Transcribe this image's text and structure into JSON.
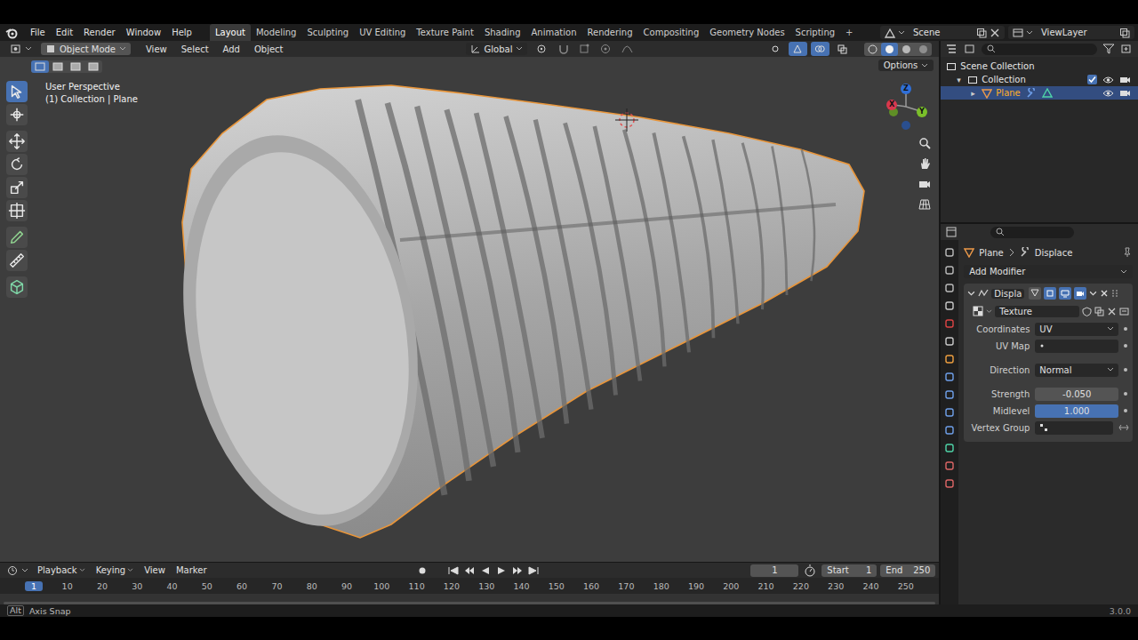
{
  "menus": [
    "File",
    "Edit",
    "Render",
    "Window",
    "Help"
  ],
  "workspaces": [
    {
      "label": "Layout",
      "selected": true
    },
    {
      "label": "Modeling",
      "selected": false
    },
    {
      "label": "Sculpting",
      "selected": false
    },
    {
      "label": "UV Editing",
      "selected": false
    },
    {
      "label": "Texture Paint",
      "selected": false
    },
    {
      "label": "Shading",
      "selected": false
    },
    {
      "label": "Animation",
      "selected": false
    },
    {
      "label": "Rendering",
      "selected": false
    },
    {
      "label": "Compositing",
      "selected": false
    },
    {
      "label": "Geometry Nodes",
      "selected": false
    },
    {
      "label": "Scripting",
      "selected": false
    }
  ],
  "add_workspace": "+",
  "scene": "Scene",
  "view_layer": "ViewLayer",
  "viewport_header": {
    "mode": "Object Mode",
    "menus": [
      "View",
      "Select",
      "Add",
      "Object"
    ],
    "orientation": "Global",
    "toggles": [
      {
        "on": false
      },
      {
        "on": true
      },
      {
        "on": true
      },
      {
        "on": false
      }
    ],
    "shading": [
      {
        "selected": false
      },
      {
        "selected": true
      },
      {
        "selected": false
      },
      {
        "selected": false
      }
    ],
    "select_modes": [
      {
        "selected": true
      },
      {
        "selected": false
      },
      {
        "selected": false
      },
      {
        "selected": false
      }
    ]
  },
  "viewport": {
    "perspective": "User Perspective",
    "context": "(1) Collection | Plane",
    "options": "Options",
    "toolbar": [
      {
        "selected": true
      },
      {
        "selected": false
      },
      {
        "selected": false
      },
      {
        "selected": false
      },
      {
        "selected": false
      },
      {
        "selected": false
      },
      {
        "selected": false
      },
      {
        "selected": false
      },
      {
        "selected": false
      }
    ],
    "gizmo_axes": [
      {
        "label": "Z",
        "color": "#2f6fd8"
      },
      {
        "label": "Y",
        "color": "#7bbf2a"
      },
      {
        "label": "X",
        "color": "#d8384e"
      }
    ]
  },
  "outliner": {
    "items": [
      {
        "label": "Scene Collection",
        "kind": "scene",
        "arrow": "",
        "selected": false
      },
      {
        "label": "Collection",
        "kind": "collection",
        "arrow": "▾",
        "checked": true,
        "selected": false
      },
      {
        "label": "Plane",
        "kind": "object",
        "arrow": "▸",
        "selected": true
      }
    ]
  },
  "properties": {
    "breadcrumb": [
      "Plane",
      "Displace"
    ],
    "add_modifier": "Add Modifier",
    "modifier": {
      "name": "Displa",
      "toggles": [
        {
          "on": false
        },
        {
          "on": true
        },
        {
          "on": true
        },
        {
          "on": true
        }
      ],
      "texture": "Texture",
      "fields": [
        {
          "label": "Coordinates",
          "value": "UV",
          "kind": "dropdown"
        },
        {
          "label": "UV Map",
          "value": "",
          "kind": "search"
        },
        {
          "label": "Direction",
          "value": "Normal",
          "kind": "dropdown"
        },
        {
          "label": "Strength",
          "value": "-0.050",
          "kind": "number"
        },
        {
          "label": "Midlevel",
          "value": "1.000",
          "kind": "slider",
          "level": 1
        },
        {
          "label": "Vertex Group",
          "value": "",
          "kind": "group"
        }
      ]
    }
  },
  "timeline": {
    "menus": [
      "Playback",
      "Keying",
      "View",
      "Marker"
    ],
    "current_frame": "1",
    "start_label": "Start",
    "start": "1",
    "end_label": "End",
    "end": "250",
    "ruler": [
      {
        "label": "1",
        "selected": true
      },
      {
        "label": "10",
        "selected": false
      },
      {
        "label": "20",
        "selected": false
      },
      {
        "label": "30",
        "selected": false
      },
      {
        "label": "40",
        "selected": false
      },
      {
        "label": "50",
        "selected": false
      },
      {
        "label": "60",
        "selected": false
      },
      {
        "label": "70",
        "selected": false
      },
      {
        "label": "80",
        "selected": false
      },
      {
        "label": "90",
        "selected": false
      },
      {
        "label": "100",
        "selected": false
      },
      {
        "label": "110",
        "selected": false
      },
      {
        "label": "120",
        "selected": false
      },
      {
        "label": "130",
        "selected": false
      },
      {
        "label": "140",
        "selected": false
      },
      {
        "label": "150",
        "selected": false
      },
      {
        "label": "160",
        "selected": false
      },
      {
        "label": "170",
        "selected": false
      },
      {
        "label": "180",
        "selected": false
      },
      {
        "label": "190",
        "selected": false
      },
      {
        "label": "200",
        "selected": false
      },
      {
        "label": "210",
        "selected": false
      },
      {
        "label": "220",
        "selected": false
      },
      {
        "label": "230",
        "selected": false
      },
      {
        "label": "240",
        "selected": false
      },
      {
        "label": "250",
        "selected": false
      }
    ]
  },
  "status": {
    "key": "Alt",
    "hint": "Axis Snap",
    "version": "3.0.0"
  }
}
